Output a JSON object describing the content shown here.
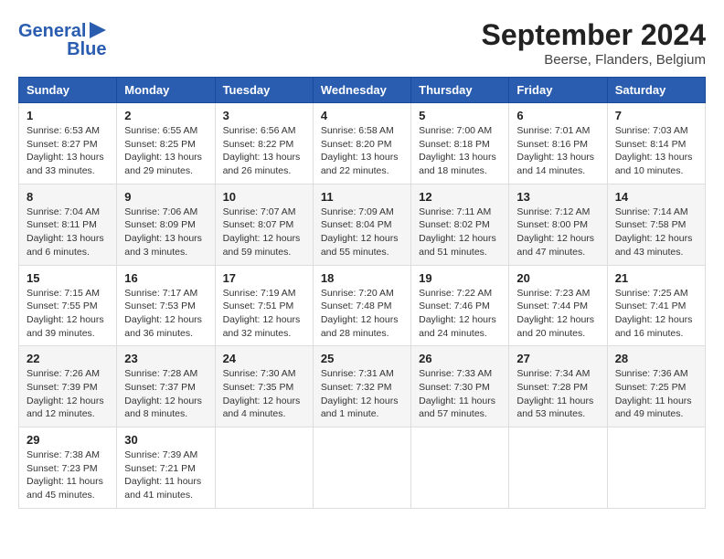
{
  "header": {
    "logo_line1": "General",
    "logo_line2": "Blue",
    "month": "September 2024",
    "location": "Beerse, Flanders, Belgium"
  },
  "weekdays": [
    "Sunday",
    "Monday",
    "Tuesday",
    "Wednesday",
    "Thursday",
    "Friday",
    "Saturday"
  ],
  "weeks": [
    [
      {
        "day": "1",
        "sunrise": "Sunrise: 6:53 AM",
        "sunset": "Sunset: 8:27 PM",
        "daylight": "Daylight: 13 hours and 33 minutes."
      },
      {
        "day": "2",
        "sunrise": "Sunrise: 6:55 AM",
        "sunset": "Sunset: 8:25 PM",
        "daylight": "Daylight: 13 hours and 29 minutes."
      },
      {
        "day": "3",
        "sunrise": "Sunrise: 6:56 AM",
        "sunset": "Sunset: 8:22 PM",
        "daylight": "Daylight: 13 hours and 26 minutes."
      },
      {
        "day": "4",
        "sunrise": "Sunrise: 6:58 AM",
        "sunset": "Sunset: 8:20 PM",
        "daylight": "Daylight: 13 hours and 22 minutes."
      },
      {
        "day": "5",
        "sunrise": "Sunrise: 7:00 AM",
        "sunset": "Sunset: 8:18 PM",
        "daylight": "Daylight: 13 hours and 18 minutes."
      },
      {
        "day": "6",
        "sunrise": "Sunrise: 7:01 AM",
        "sunset": "Sunset: 8:16 PM",
        "daylight": "Daylight: 13 hours and 14 minutes."
      },
      {
        "day": "7",
        "sunrise": "Sunrise: 7:03 AM",
        "sunset": "Sunset: 8:14 PM",
        "daylight": "Daylight: 13 hours and 10 minutes."
      }
    ],
    [
      {
        "day": "8",
        "sunrise": "Sunrise: 7:04 AM",
        "sunset": "Sunset: 8:11 PM",
        "daylight": "Daylight: 13 hours and 6 minutes."
      },
      {
        "day": "9",
        "sunrise": "Sunrise: 7:06 AM",
        "sunset": "Sunset: 8:09 PM",
        "daylight": "Daylight: 13 hours and 3 minutes."
      },
      {
        "day": "10",
        "sunrise": "Sunrise: 7:07 AM",
        "sunset": "Sunset: 8:07 PM",
        "daylight": "Daylight: 12 hours and 59 minutes."
      },
      {
        "day": "11",
        "sunrise": "Sunrise: 7:09 AM",
        "sunset": "Sunset: 8:04 PM",
        "daylight": "Daylight: 12 hours and 55 minutes."
      },
      {
        "day": "12",
        "sunrise": "Sunrise: 7:11 AM",
        "sunset": "Sunset: 8:02 PM",
        "daylight": "Daylight: 12 hours and 51 minutes."
      },
      {
        "day": "13",
        "sunrise": "Sunrise: 7:12 AM",
        "sunset": "Sunset: 8:00 PM",
        "daylight": "Daylight: 12 hours and 47 minutes."
      },
      {
        "day": "14",
        "sunrise": "Sunrise: 7:14 AM",
        "sunset": "Sunset: 7:58 PM",
        "daylight": "Daylight: 12 hours and 43 minutes."
      }
    ],
    [
      {
        "day": "15",
        "sunrise": "Sunrise: 7:15 AM",
        "sunset": "Sunset: 7:55 PM",
        "daylight": "Daylight: 12 hours and 39 minutes."
      },
      {
        "day": "16",
        "sunrise": "Sunrise: 7:17 AM",
        "sunset": "Sunset: 7:53 PM",
        "daylight": "Daylight: 12 hours and 36 minutes."
      },
      {
        "day": "17",
        "sunrise": "Sunrise: 7:19 AM",
        "sunset": "Sunset: 7:51 PM",
        "daylight": "Daylight: 12 hours and 32 minutes."
      },
      {
        "day": "18",
        "sunrise": "Sunrise: 7:20 AM",
        "sunset": "Sunset: 7:48 PM",
        "daylight": "Daylight: 12 hours and 28 minutes."
      },
      {
        "day": "19",
        "sunrise": "Sunrise: 7:22 AM",
        "sunset": "Sunset: 7:46 PM",
        "daylight": "Daylight: 12 hours and 24 minutes."
      },
      {
        "day": "20",
        "sunrise": "Sunrise: 7:23 AM",
        "sunset": "Sunset: 7:44 PM",
        "daylight": "Daylight: 12 hours and 20 minutes."
      },
      {
        "day": "21",
        "sunrise": "Sunrise: 7:25 AM",
        "sunset": "Sunset: 7:41 PM",
        "daylight": "Daylight: 12 hours and 16 minutes."
      }
    ],
    [
      {
        "day": "22",
        "sunrise": "Sunrise: 7:26 AM",
        "sunset": "Sunset: 7:39 PM",
        "daylight": "Daylight: 12 hours and 12 minutes."
      },
      {
        "day": "23",
        "sunrise": "Sunrise: 7:28 AM",
        "sunset": "Sunset: 7:37 PM",
        "daylight": "Daylight: 12 hours and 8 minutes."
      },
      {
        "day": "24",
        "sunrise": "Sunrise: 7:30 AM",
        "sunset": "Sunset: 7:35 PM",
        "daylight": "Daylight: 12 hours and 4 minutes."
      },
      {
        "day": "25",
        "sunrise": "Sunrise: 7:31 AM",
        "sunset": "Sunset: 7:32 PM",
        "daylight": "Daylight: 12 hours and 1 minute."
      },
      {
        "day": "26",
        "sunrise": "Sunrise: 7:33 AM",
        "sunset": "Sunset: 7:30 PM",
        "daylight": "Daylight: 11 hours and 57 minutes."
      },
      {
        "day": "27",
        "sunrise": "Sunrise: 7:34 AM",
        "sunset": "Sunset: 7:28 PM",
        "daylight": "Daylight: 11 hours and 53 minutes."
      },
      {
        "day": "28",
        "sunrise": "Sunrise: 7:36 AM",
        "sunset": "Sunset: 7:25 PM",
        "daylight": "Daylight: 11 hours and 49 minutes."
      }
    ],
    [
      {
        "day": "29",
        "sunrise": "Sunrise: 7:38 AM",
        "sunset": "Sunset: 7:23 PM",
        "daylight": "Daylight: 11 hours and 45 minutes."
      },
      {
        "day": "30",
        "sunrise": "Sunrise: 7:39 AM",
        "sunset": "Sunset: 7:21 PM",
        "daylight": "Daylight: 11 hours and 41 minutes."
      },
      null,
      null,
      null,
      null,
      null
    ]
  ]
}
